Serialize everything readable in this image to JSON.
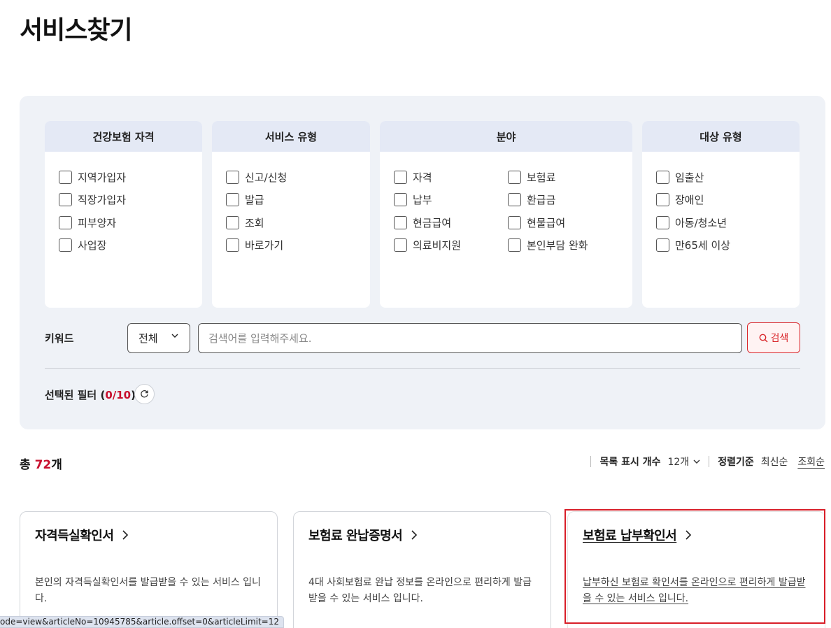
{
  "page": {
    "title": "서비스찾기"
  },
  "filters": {
    "groups": [
      {
        "title": "건강보험 자격",
        "options": [
          "지역가입자",
          "직장가입자",
          "피부양자",
          "사업장"
        ]
      },
      {
        "title": "서비스 유형",
        "options": [
          "신고/신청",
          "발급",
          "조회",
          "바로가기"
        ]
      },
      {
        "title": "분야",
        "options": [
          "자격",
          "보험료",
          "납부",
          "환급금",
          "현금급여",
          "현물급여",
          "의료비지원",
          "본인부담 완화"
        ]
      },
      {
        "title": "대상 유형",
        "options": [
          "임출산",
          "장애인",
          "아동/청소년",
          "만65세 이상"
        ]
      }
    ],
    "keyword_label": "키워드",
    "scope_value": "전체",
    "search_placeholder": "검색어를 입력해주세요.",
    "search_button": "검색",
    "selected_label": "선택된 필터 (",
    "selected_count": "0/10",
    "selected_close": ")"
  },
  "results": {
    "total_prefix": "총 ",
    "total_count": "72",
    "total_suffix": "개",
    "list_count_label": "목록 표시 개수",
    "list_count_value": "12개",
    "sort_label": "정렬기준",
    "sort_options": [
      "최신순",
      "조회순"
    ],
    "sort_active": "조회순"
  },
  "cards": [
    {
      "title": "자격득실확인서",
      "desc": "본인의 자격득실확인서를 발급받을 수 있는 서비스 입니다."
    },
    {
      "title": "보험료 완납증명서",
      "desc": "4대 사회보험료 완납 정보를 온라인으로 편리하게 발급받을 수 있는 서비스 입니다."
    },
    {
      "title": "보험료 납부확인서",
      "desc": "납부하신 보험료 확인서를 온라인으로 편리하게 발급받을 수 있는 서비스 입니다."
    }
  ],
  "status_bar": {
    "url": "ode=view&articleNo=10945785&article.offset=0&articleLimit=12"
  },
  "colors": {
    "accent": "#c8102e",
    "panel": "#eff2f7",
    "filter_head": "#e4e9f5",
    "highlight": "#d81e28"
  }
}
